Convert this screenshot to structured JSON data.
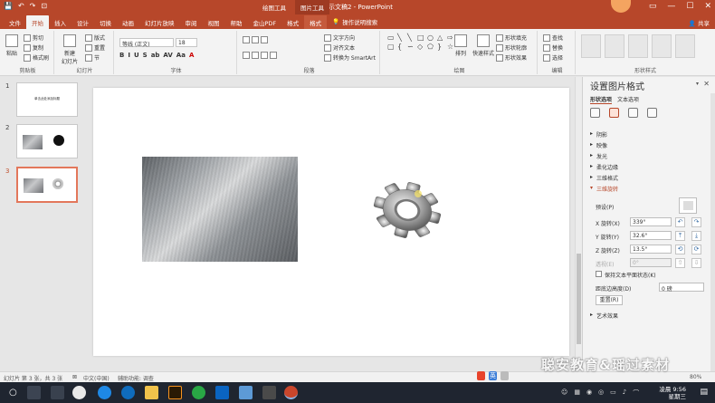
{
  "titlebar": {
    "title": "演示文稿2 - PowerPoint",
    "context_tab_1": "绘图工具",
    "context_tab_2": "图片工具",
    "quick_access": [
      "💾",
      "↶",
      "↷",
      "⊡"
    ],
    "window_buttons": [
      "▭",
      "—",
      "☐",
      "✕"
    ]
  },
  "tabs": {
    "items": [
      "文件",
      "开始",
      "插入",
      "设计",
      "切换",
      "动画",
      "幻灯片放映",
      "审阅",
      "视图",
      "帮助",
      "金山PDF",
      "格式",
      "格式"
    ],
    "active_index": 1,
    "tell_me": "操作说明搜索",
    "share": "共享"
  },
  "ribbon": {
    "clipboard": {
      "paste": "粘贴",
      "cut": "剪切",
      "copy": "复制",
      "format_painter": "格式刷",
      "group": "剪贴板"
    },
    "slides": {
      "new_slide": "新建\n幻灯片",
      "layout": "版式",
      "reset": "重置",
      "section": "节",
      "group": "幻灯片"
    },
    "font": {
      "font_name": "等线 (正文)",
      "font_size": "18",
      "buttons": [
        "B",
        "I",
        "U",
        "S",
        "ab",
        "AV",
        "Aa",
        "A"
      ],
      "group": "字体"
    },
    "paragraph": {
      "text_direction": "文字方向",
      "align_text": "对齐文本",
      "smartart": "转换为 SmartArt",
      "group": "段落"
    },
    "drawing": {
      "arrange": "排列",
      "quick_styles": "快速样式",
      "shape_fill": "形状填充",
      "shape_outline": "形状轮廓",
      "shape_effects": "形状效果",
      "group": "绘图"
    },
    "editing": {
      "find": "查找",
      "replace": "替换",
      "select": "选择",
      "group": "编辑"
    },
    "shape_styles_group": "形状样式"
  },
  "slides": [
    {
      "num": "1",
      "title": "单击此处添加标题"
    },
    {
      "num": "2"
    },
    {
      "num": "3"
    }
  ],
  "pane": {
    "title": "设置图片格式",
    "tabs": [
      "形状选项",
      "文本选项"
    ],
    "sections": [
      "阴影",
      "映像",
      "发光",
      "柔化边缘",
      "三维格式",
      "三维旋转"
    ],
    "preset_label": "预设(P)",
    "rows": [
      {
        "label": "X 旋转(X)",
        "value": "339°"
      },
      {
        "label": "Y 旋转(Y)",
        "value": "32.6°"
      },
      {
        "label": "Z 旋转(Z)",
        "value": "13.5°"
      },
      {
        "label": "透视(E)",
        "value": "0°"
      }
    ],
    "keep_flat": "保持文本平面状态(K)",
    "distance_label": "距底边高度(D)",
    "distance_value": "0 磅",
    "reset": "重置(R)",
    "art_effects": "艺术效果"
  },
  "status": {
    "slide_info": "幻灯片 第 3 张，共 3 张",
    "language": "中文(中国)",
    "accessibility": "辅助功能: 调查",
    "zoom": "80%"
  },
  "watermark": "聪安教育&瑶过素材",
  "taskbar": {
    "time": "凌晨 9:56",
    "date": "星期三",
    "ime": "英",
    "icons": [
      "start",
      "cortana",
      "taskview",
      "photos",
      "ie",
      "edge",
      "explorer",
      "illustrator",
      "chrome",
      "wechat",
      "outlook",
      "app",
      "app",
      "powerpoint"
    ]
  },
  "colors": {
    "accent": "#b7472a",
    "taskbar": "#1f2530"
  }
}
